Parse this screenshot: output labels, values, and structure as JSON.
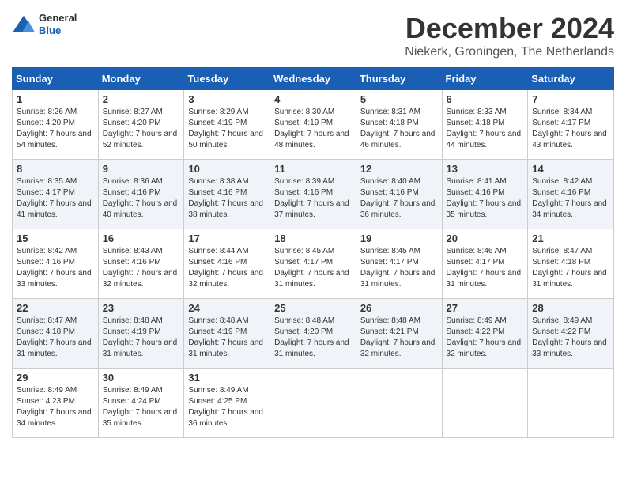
{
  "logo": {
    "general": "General",
    "blue": "Blue"
  },
  "title": "December 2024",
  "subtitle": "Niekerk, Groningen, The Netherlands",
  "days": [
    "Sunday",
    "Monday",
    "Tuesday",
    "Wednesday",
    "Thursday",
    "Friday",
    "Saturday"
  ],
  "weeks": [
    [
      {
        "day": "1",
        "sunrise": "8:26 AM",
        "sunset": "4:20 PM",
        "daylight": "7 hours and 54 minutes."
      },
      {
        "day": "2",
        "sunrise": "8:27 AM",
        "sunset": "4:20 PM",
        "daylight": "7 hours and 52 minutes."
      },
      {
        "day": "3",
        "sunrise": "8:29 AM",
        "sunset": "4:19 PM",
        "daylight": "7 hours and 50 minutes."
      },
      {
        "day": "4",
        "sunrise": "8:30 AM",
        "sunset": "4:19 PM",
        "daylight": "7 hours and 48 minutes."
      },
      {
        "day": "5",
        "sunrise": "8:31 AM",
        "sunset": "4:18 PM",
        "daylight": "7 hours and 46 minutes."
      },
      {
        "day": "6",
        "sunrise": "8:33 AM",
        "sunset": "4:18 PM",
        "daylight": "7 hours and 44 minutes."
      },
      {
        "day": "7",
        "sunrise": "8:34 AM",
        "sunset": "4:17 PM",
        "daylight": "7 hours and 43 minutes."
      }
    ],
    [
      {
        "day": "8",
        "sunrise": "8:35 AM",
        "sunset": "4:17 PM",
        "daylight": "7 hours and 41 minutes."
      },
      {
        "day": "9",
        "sunrise": "8:36 AM",
        "sunset": "4:16 PM",
        "daylight": "7 hours and 40 minutes."
      },
      {
        "day": "10",
        "sunrise": "8:38 AM",
        "sunset": "4:16 PM",
        "daylight": "7 hours and 38 minutes."
      },
      {
        "day": "11",
        "sunrise": "8:39 AM",
        "sunset": "4:16 PM",
        "daylight": "7 hours and 37 minutes."
      },
      {
        "day": "12",
        "sunrise": "8:40 AM",
        "sunset": "4:16 PM",
        "daylight": "7 hours and 36 minutes."
      },
      {
        "day": "13",
        "sunrise": "8:41 AM",
        "sunset": "4:16 PM",
        "daylight": "7 hours and 35 minutes."
      },
      {
        "day": "14",
        "sunrise": "8:42 AM",
        "sunset": "4:16 PM",
        "daylight": "7 hours and 34 minutes."
      }
    ],
    [
      {
        "day": "15",
        "sunrise": "8:42 AM",
        "sunset": "4:16 PM",
        "daylight": "7 hours and 33 minutes."
      },
      {
        "day": "16",
        "sunrise": "8:43 AM",
        "sunset": "4:16 PM",
        "daylight": "7 hours and 32 minutes."
      },
      {
        "day": "17",
        "sunrise": "8:44 AM",
        "sunset": "4:16 PM",
        "daylight": "7 hours and 32 minutes."
      },
      {
        "day": "18",
        "sunrise": "8:45 AM",
        "sunset": "4:17 PM",
        "daylight": "7 hours and 31 minutes."
      },
      {
        "day": "19",
        "sunrise": "8:45 AM",
        "sunset": "4:17 PM",
        "daylight": "7 hours and 31 minutes."
      },
      {
        "day": "20",
        "sunrise": "8:46 AM",
        "sunset": "4:17 PM",
        "daylight": "7 hours and 31 minutes."
      },
      {
        "day": "21",
        "sunrise": "8:47 AM",
        "sunset": "4:18 PM",
        "daylight": "7 hours and 31 minutes."
      }
    ],
    [
      {
        "day": "22",
        "sunrise": "8:47 AM",
        "sunset": "4:18 PM",
        "daylight": "7 hours and 31 minutes."
      },
      {
        "day": "23",
        "sunrise": "8:48 AM",
        "sunset": "4:19 PM",
        "daylight": "7 hours and 31 minutes."
      },
      {
        "day": "24",
        "sunrise": "8:48 AM",
        "sunset": "4:19 PM",
        "daylight": "7 hours and 31 minutes."
      },
      {
        "day": "25",
        "sunrise": "8:48 AM",
        "sunset": "4:20 PM",
        "daylight": "7 hours and 31 minutes."
      },
      {
        "day": "26",
        "sunrise": "8:48 AM",
        "sunset": "4:21 PM",
        "daylight": "7 hours and 32 minutes."
      },
      {
        "day": "27",
        "sunrise": "8:49 AM",
        "sunset": "4:22 PM",
        "daylight": "7 hours and 32 minutes."
      },
      {
        "day": "28",
        "sunrise": "8:49 AM",
        "sunset": "4:22 PM",
        "daylight": "7 hours and 33 minutes."
      }
    ],
    [
      {
        "day": "29",
        "sunrise": "8:49 AM",
        "sunset": "4:23 PM",
        "daylight": "7 hours and 34 minutes."
      },
      {
        "day": "30",
        "sunrise": "8:49 AM",
        "sunset": "4:24 PM",
        "daylight": "7 hours and 35 minutes."
      },
      {
        "day": "31",
        "sunrise": "8:49 AM",
        "sunset": "4:25 PM",
        "daylight": "7 hours and 36 minutes."
      },
      null,
      null,
      null,
      null
    ]
  ]
}
